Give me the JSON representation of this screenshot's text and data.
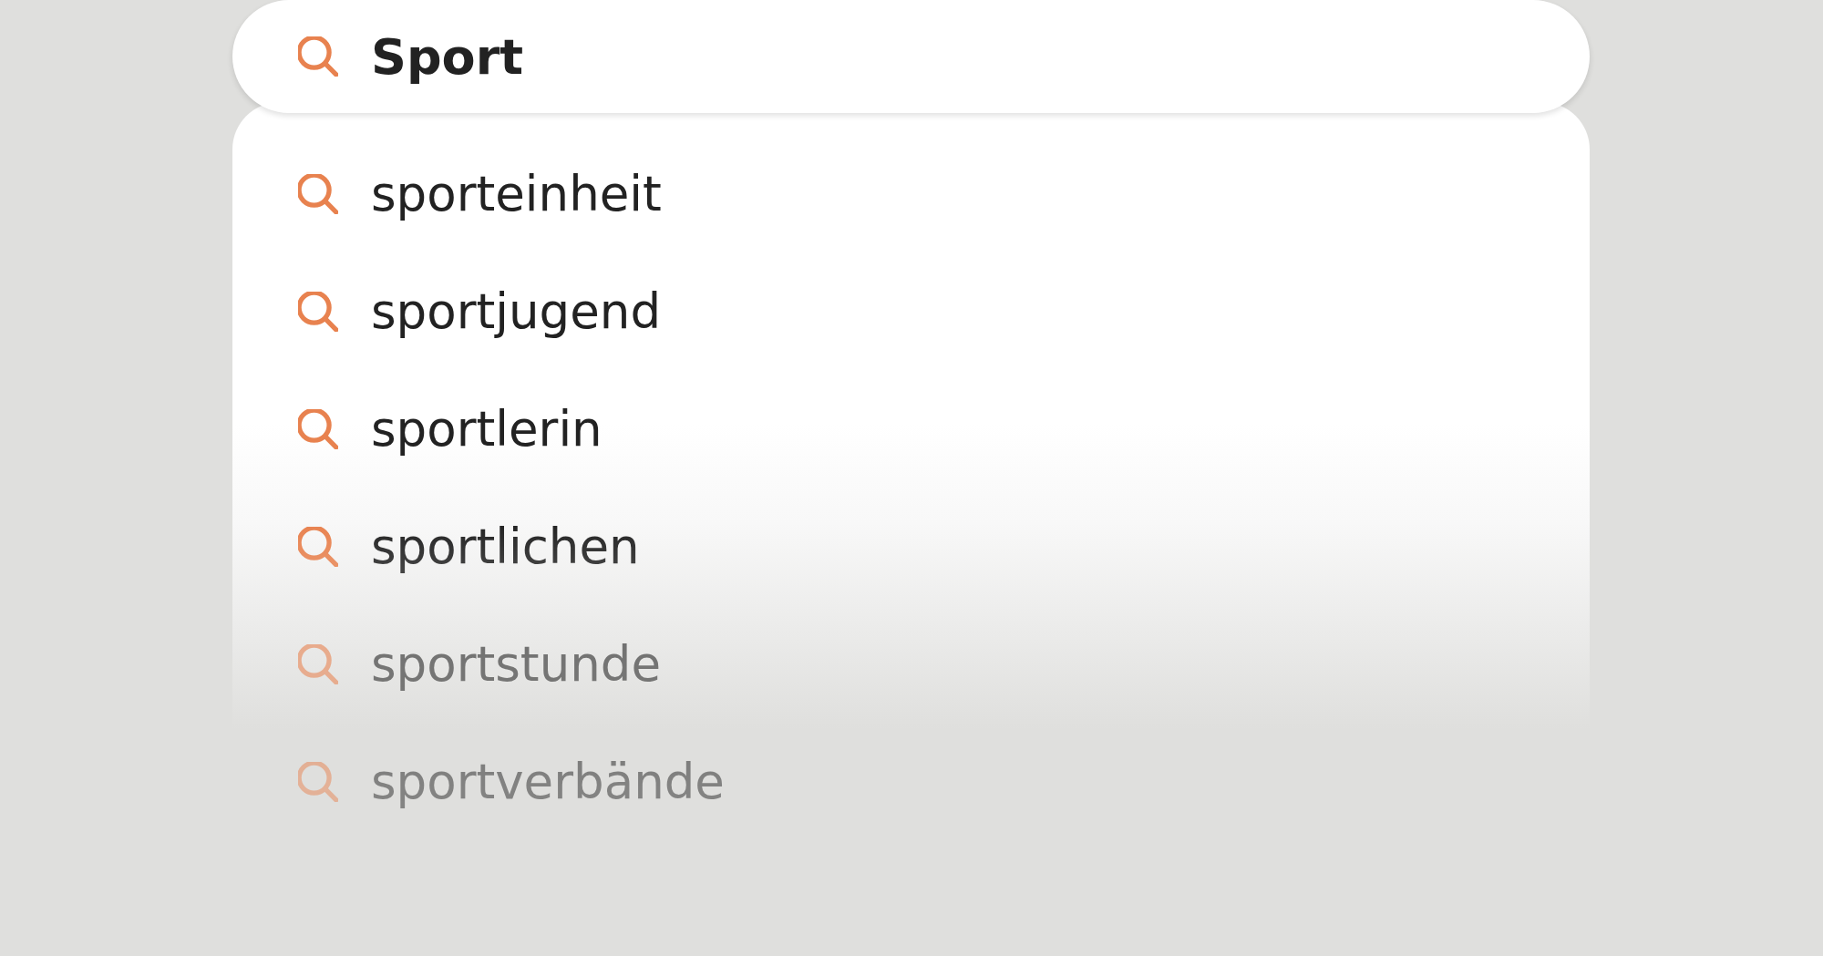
{
  "search": {
    "value": "Sport"
  },
  "suggestions": [
    {
      "text": "sporteinheit"
    },
    {
      "text": "sportjugend"
    },
    {
      "text": "sportlerin"
    },
    {
      "text": "sportlichen"
    },
    {
      "text": "sportstunde"
    },
    {
      "text": "sportverbände"
    }
  ]
}
